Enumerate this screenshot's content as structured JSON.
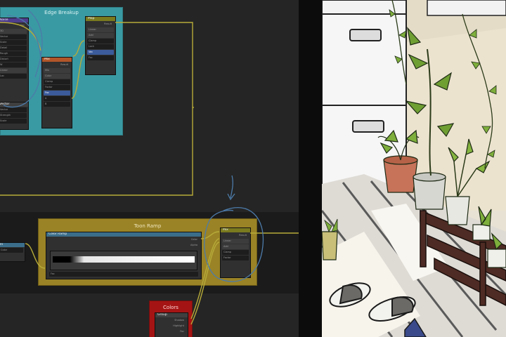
{
  "editor": {
    "frame_edge": {
      "title": "Edge Breakup",
      "color": "#3a9aa3"
    },
    "frame_toon": {
      "title": "Toon Ramp",
      "color": "#9a8326"
    },
    "frame_colors": {
      "title": "Colors",
      "color": "#a51414"
    },
    "ramp_node": {
      "title": "Color Ramp"
    },
    "colors_node": {
      "inputs": [
        "Shadow",
        "Highlight",
        "Fac"
      ]
    },
    "link_color": "#b7ab39",
    "annotation_color": "#4c7aa8"
  },
  "illustration": {
    "description_colors": {
      "wall": "#ece3cf",
      "floor": "#dddcd8",
      "cabinet": "#f3f3f3"
    }
  }
}
